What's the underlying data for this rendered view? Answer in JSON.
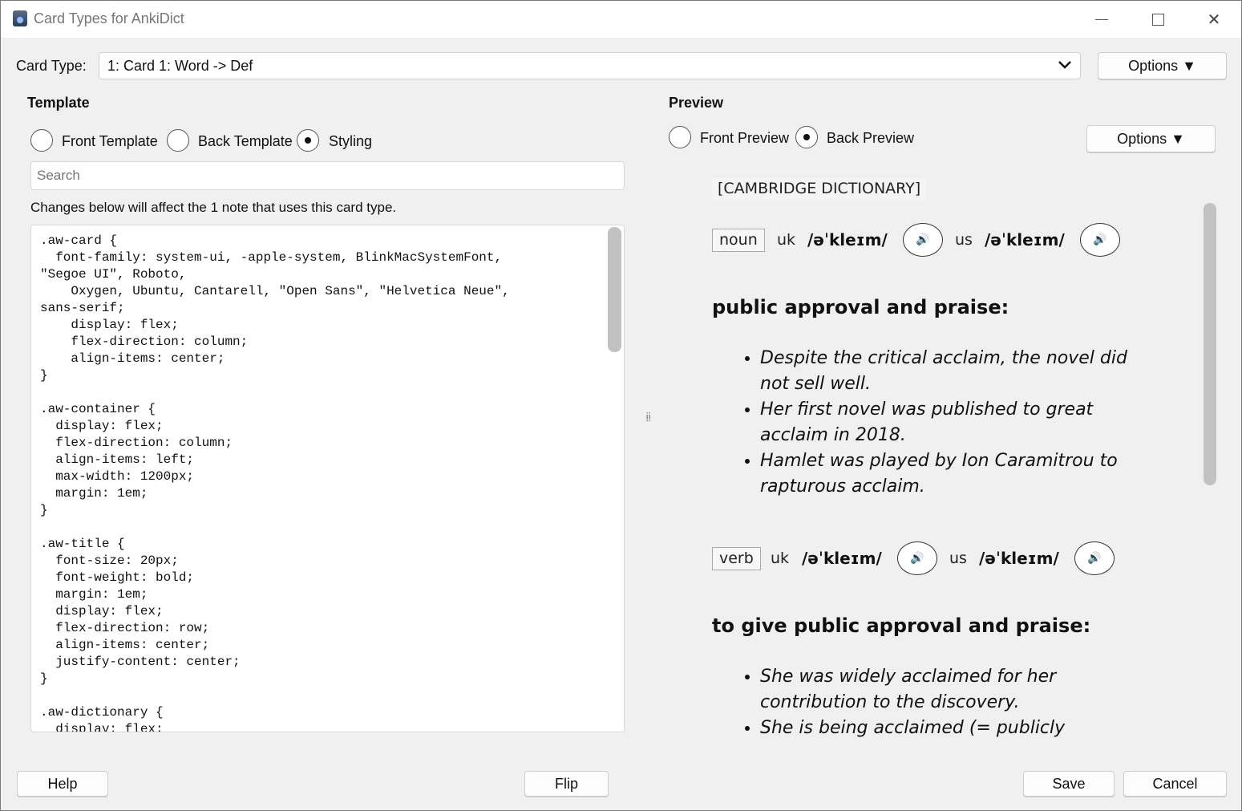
{
  "window": {
    "title": "Card Types for AnkiDict"
  },
  "card_type": {
    "label": "Card Type:",
    "selected": "1: Card 1: Word -> Def",
    "options_label": "Options ▼"
  },
  "template": {
    "title": "Template",
    "radios": [
      {
        "label": "Front Template",
        "checked": false
      },
      {
        "label": "Back Template",
        "checked": false
      },
      {
        "label": "Styling",
        "checked": true
      }
    ],
    "search_placeholder": "Search",
    "notice": "Changes below will affect the 1 note that uses this card type.",
    "code": ".aw-card {\n  font-family: system-ui, -apple-system, BlinkMacSystemFont,\n\"Segoe UI\", Roboto,\n    Oxygen, Ubuntu, Cantarell, \"Open Sans\", \"Helvetica Neue\",\nsans-serif;\n    display: flex;\n    flex-direction: column;\n    align-items: center;\n}\n\n.aw-container {\n  display: flex;\n  flex-direction: column;\n  align-items: left;\n  max-width: 1200px;\n  margin: 1em;\n}\n\n.aw-title {\n  font-size: 20px;\n  font-weight: bold;\n  margin: 1em;\n  display: flex;\n  flex-direction: row;\n  align-items: center;\n  justify-content: center;\n}\n\n.aw-dictionary {\n  display: flex;"
  },
  "preview": {
    "title": "Preview",
    "radios": [
      {
        "label": "Front Preview",
        "checked": false
      },
      {
        "label": "Back Preview",
        "checked": true
      }
    ],
    "options_label": "Options ▼",
    "dictionary": "[CAMBRIDGE DICTIONARY]",
    "entries": [
      {
        "pos": "noun",
        "uk_label": "uk",
        "uk_ipa": "/əˈkleɪm/",
        "us_label": "us",
        "us_ipa": "/əˈkleɪm/",
        "sense": "public approval and praise:",
        "examples": [
          "Despite the critical acclaim, the novel did not sell well.",
          "Her first novel was published to great acclaim in 2018.",
          "Hamlet was played by Ion Caramitrou to rapturous acclaim."
        ]
      },
      {
        "pos": "verb",
        "uk_label": "uk",
        "uk_ipa": "/əˈkleɪm/",
        "us_label": "us",
        "us_ipa": "/əˈkleɪm/",
        "sense": "to give public approval and praise:",
        "examples": [
          "She was widely acclaimed for her contribution to the discovery.",
          "She is being acclaimed (= publicly recognized)"
        ]
      }
    ]
  },
  "footer": {
    "help": "Help",
    "flip": "Flip",
    "save": "Save",
    "cancel": "Cancel"
  }
}
